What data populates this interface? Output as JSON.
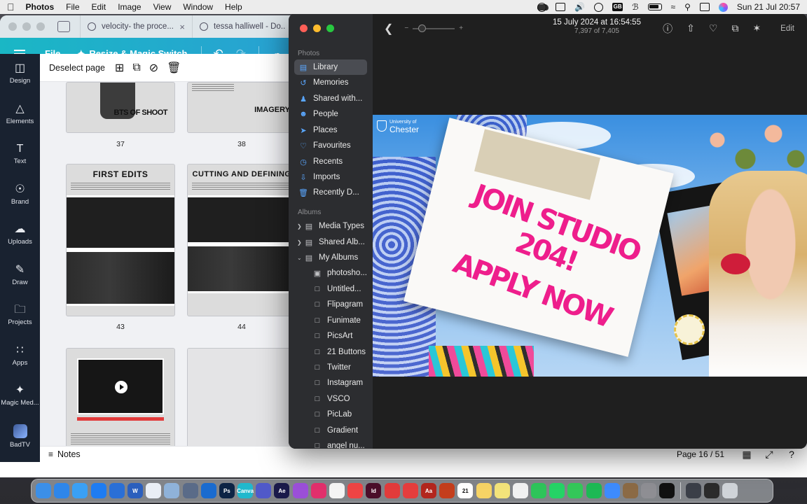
{
  "menubar": {
    "app_name": "Photos",
    "menus": [
      "File",
      "Edit",
      "Image",
      "View",
      "Window",
      "Help"
    ],
    "datetime": "Sun 21 Jul  20:57",
    "status_icons": [
      "cloud-icon",
      "creative-cloud-icon",
      "bars-icon",
      "volume-icon",
      "play-circle-icon",
      "input-gb-icon",
      "bluetooth-icon",
      "battery-icon",
      "wifi-icon",
      "search-icon",
      "control-center-icon",
      "siri-icon"
    ]
  },
  "browser": {
    "tabs": [
      {
        "label": "velocity- the proce...",
        "icon": "document-icon"
      },
      {
        "label": "tessa halliwell - Do...",
        "icon": "canva-icon"
      }
    ]
  },
  "canva": {
    "toolbar": {
      "file_label": "File",
      "resize_label": "Resize & Magic Switch"
    },
    "sidebar": [
      {
        "label": "Design",
        "icon": "design-icon"
      },
      {
        "label": "Elements",
        "icon": "elements-icon"
      },
      {
        "label": "Text",
        "icon": "text-icon"
      },
      {
        "label": "Brand",
        "icon": "brand-icon"
      },
      {
        "label": "Uploads",
        "icon": "uploads-icon"
      },
      {
        "label": "Draw",
        "icon": "draw-icon"
      },
      {
        "label": "Projects",
        "icon": "projects-icon"
      },
      {
        "label": "Apps",
        "icon": "apps-icon"
      },
      {
        "label": "Magic Med...",
        "icon": "magic-media-icon"
      },
      {
        "label": "BadTV",
        "icon": "badtv-icon"
      }
    ],
    "page_toolbar": {
      "deselect_label": "Deselect page"
    },
    "pages": {
      "p37": {
        "number": "37",
        "label": "BTS OF SHOOT"
      },
      "p38": {
        "number": "38",
        "label": "IMAGERY"
      },
      "p43": {
        "number": "43",
        "heading": "FIRST EDITS"
      },
      "p44": {
        "number": "44",
        "heading": "CUTTING AND DEFINING"
      }
    },
    "footer": {
      "notes_label": "Notes",
      "page_indicator": "Page 16 / 51"
    }
  },
  "photos": {
    "sidebar": {
      "section_photos": "Photos",
      "section_albums": "Albums",
      "library_items": [
        {
          "label": "Library",
          "icon": "library-icon"
        },
        {
          "label": "Memories",
          "icon": "memories-icon"
        },
        {
          "label": "Shared with...",
          "icon": "shared-icon"
        },
        {
          "label": "People",
          "icon": "people-icon"
        },
        {
          "label": "Places",
          "icon": "places-icon"
        },
        {
          "label": "Favourites",
          "icon": "heart-icon"
        },
        {
          "label": "Recents",
          "icon": "clock-icon"
        },
        {
          "label": "Imports",
          "icon": "imports-icon"
        },
        {
          "label": "Recently D...",
          "icon": "trash-icon"
        }
      ],
      "album_items": [
        {
          "label": "Media Types",
          "icon": "folder-icon",
          "expandable": true
        },
        {
          "label": "Shared Alb...",
          "icon": "folder-icon",
          "expandable": true
        },
        {
          "label": "My Albums",
          "icon": "folder-icon",
          "expandable": true,
          "expanded": true
        },
        {
          "label": "photosho...",
          "icon": "album-thumb-icon"
        },
        {
          "label": "Untitled...",
          "icon": "album-icon"
        },
        {
          "label": "Flipagram",
          "icon": "album-icon"
        },
        {
          "label": "Funimate",
          "icon": "album-icon"
        },
        {
          "label": "PicsArt",
          "icon": "album-icon"
        },
        {
          "label": "21 Buttons",
          "icon": "album-icon"
        },
        {
          "label": "Twitter",
          "icon": "album-icon"
        },
        {
          "label": "Instagram",
          "icon": "album-icon"
        },
        {
          "label": "VSCO",
          "icon": "album-icon"
        },
        {
          "label": "PicLab",
          "icon": "album-icon"
        },
        {
          "label": "Gradient",
          "icon": "album-icon"
        },
        {
          "label": "angel nu...",
          "icon": "album-icon"
        }
      ]
    },
    "viewer": {
      "date": "15 July 2024 at 16:54:55",
      "count": "7,397 of 7,405",
      "edit_label": "Edit",
      "zoom_minus": "−",
      "zoom_plus": "+"
    },
    "photo": {
      "logo_small": "University of",
      "logo_big": "Chester",
      "headline_1": "JOIN STUDIO 204!",
      "headline_2": "APPLY NOW"
    }
  },
  "dock": {
    "apps": [
      {
        "name": "finder",
        "color": "#3b8fe8"
      },
      {
        "name": "safari",
        "color": "#2e86ea"
      },
      {
        "name": "mail",
        "color": "#3aa0f5"
      },
      {
        "name": "app-store",
        "color": "#1e7cf2"
      },
      {
        "name": "clipchamp",
        "color": "#2a6fd6"
      },
      {
        "name": "word",
        "color": "#2b5fbd"
      },
      {
        "name": "freeform",
        "color": "#e9eef6"
      },
      {
        "name": "preview",
        "color": "#8fb2d9"
      },
      {
        "name": "teams-photo",
        "color": "#5a6b88"
      },
      {
        "name": "outlook",
        "color": "#1a6bcf"
      },
      {
        "name": "photoshop",
        "color": "#0d2445"
      },
      {
        "name": "canva",
        "color": "#20b8cd"
      },
      {
        "name": "teams",
        "color": "#5059c9"
      },
      {
        "name": "after-effects",
        "color": "#1a1a4a"
      },
      {
        "name": "podcasts",
        "color": "#9b4fd8"
      },
      {
        "name": "instagram",
        "color": "#e1306c"
      },
      {
        "name": "photos",
        "color": "#f4f4f4"
      },
      {
        "name": "calendar-red",
        "color": "#ef4444"
      },
      {
        "name": "indesign",
        "color": "#4b0e2a"
      },
      {
        "name": "flashcards",
        "color": "#e23b3b"
      },
      {
        "name": "mail-red",
        "color": "#e53d3d"
      },
      {
        "name": "dictionary",
        "color": "#b3261e"
      },
      {
        "name": "powerpoint",
        "color": "#c43e1c"
      },
      {
        "name": "calendar",
        "color": "#ffffff"
      },
      {
        "name": "notes",
        "color": "#f6d365"
      },
      {
        "name": "stickies",
        "color": "#f3e37a"
      },
      {
        "name": "chrome",
        "color": "#f1f1f1"
      },
      {
        "name": "facetime",
        "color": "#2ec45a"
      },
      {
        "name": "whatsapp",
        "color": "#25d366"
      },
      {
        "name": "messages",
        "color": "#34c759"
      },
      {
        "name": "spotify",
        "color": "#1db954"
      },
      {
        "name": "translate",
        "color": "#3d8bfd"
      },
      {
        "name": "archive",
        "color": "#8b6a45"
      },
      {
        "name": "settings",
        "color": "#8e8e93"
      },
      {
        "name": "capcut",
        "color": "#111111"
      },
      {
        "name": "migration",
        "color": "#3b3f48"
      },
      {
        "name": "terminal",
        "color": "#2b2b2b"
      },
      {
        "name": "trash",
        "color": "#cfd3d8"
      }
    ],
    "labels": {
      "photoshop": "Ps",
      "after-effects": "Ae",
      "indesign": "Id",
      "dictionary": "Aa",
      "word": "W",
      "calendar": "21",
      "canva": "Canva"
    }
  }
}
